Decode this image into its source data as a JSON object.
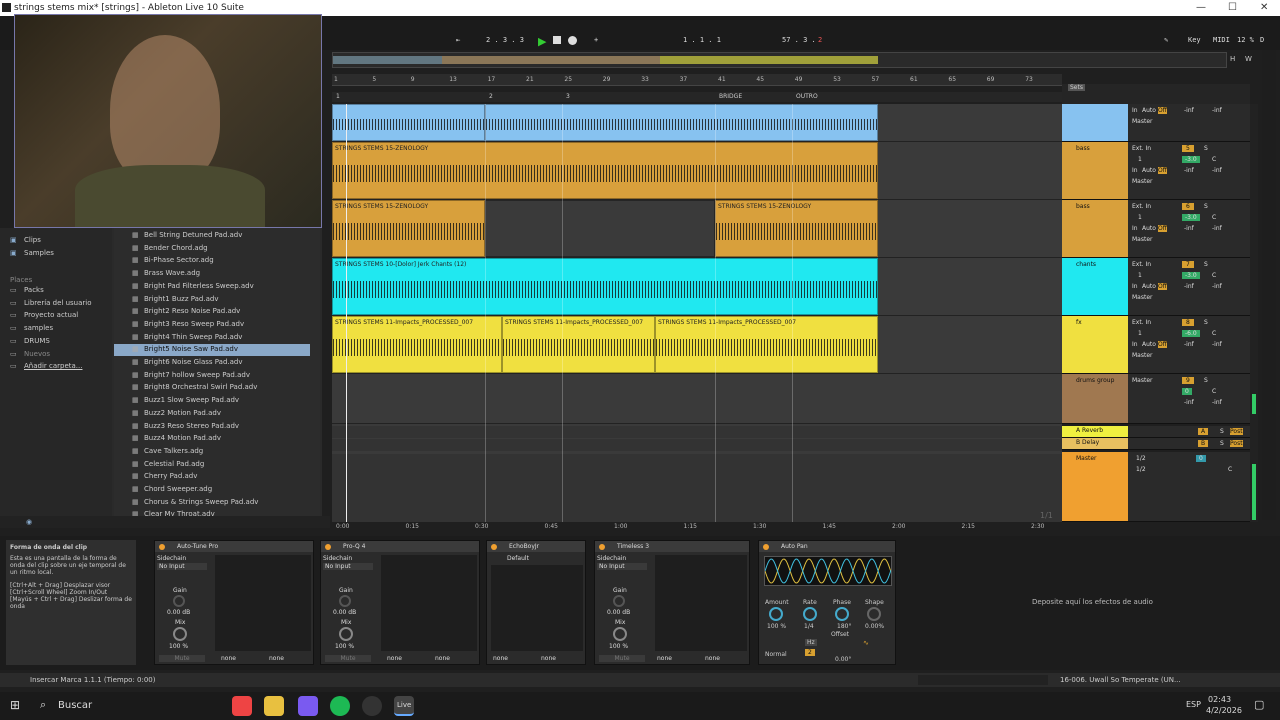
{
  "window": {
    "title": "strings stems mix* [strings] - Ableton Live 10 Suite",
    "minimize": "—",
    "maximize": "☐",
    "close": "✕"
  },
  "transport": {
    "tempo_nudge": "2 . 3 . 3",
    "position": "1 . 1 . 1",
    "loop_len": "57 . 3 .",
    "loop_len_end": "2",
    "key_label": "Key",
    "midi_label": "MIDI",
    "cpu": "12 %",
    "cpu_d": "D"
  },
  "ruler": {
    "bars": [
      "1",
      "5",
      "9",
      "13",
      "17",
      "21",
      "25",
      "29",
      "33",
      "37",
      "41",
      "45",
      "49",
      "53",
      "57",
      "61",
      "65",
      "69",
      "73"
    ]
  },
  "locators": [
    {
      "label": "1"
    },
    {
      "label": "2"
    },
    {
      "label": "3"
    },
    {
      "label": "BRIDGE"
    },
    {
      "label": "OUTRO"
    }
  ],
  "tracks": [
    {
      "name": "",
      "clips": [
        {
          "label": ""
        }
      ],
      "color": "#87c2f0",
      "routing": "Master",
      "vol": "-inf",
      "vol2": "-inf",
      "auto": "Auto",
      "off": "Off",
      "in": "In"
    },
    {
      "name": "bass",
      "clips": [
        {
          "label": "STRINGS STEMS 15-ZENOLOGY"
        }
      ],
      "color": "#d8a03c",
      "ext": "Ext. In",
      "ch": "1",
      "num": "5",
      "s": "S",
      "val": "-3.0",
      "pan": "C",
      "routing": "Master",
      "vol": "-inf",
      "vol2": "-inf",
      "auto": "Auto",
      "off": "Off",
      "in": "In"
    },
    {
      "name": "bass",
      "clips": [
        {
          "label": "STRINGS STEMS 15-ZENOLOGY"
        },
        {
          "label": "STRINGS STEMS 15-ZENOLOGY"
        }
      ],
      "color": "#d8a03c",
      "ext": "Ext. In",
      "ch": "1",
      "num": "6",
      "s": "S",
      "val": "-3.0",
      "pan": "C",
      "routing": "Master",
      "vol": "-inf",
      "vol2": "-inf",
      "auto": "Auto",
      "off": "Off",
      "in": "In"
    },
    {
      "name": "chants",
      "clips": [
        {
          "label": "STRINGS STEMS 10-[Dolor] Jerk Chants (12)"
        }
      ],
      "color": "#20e8f0",
      "ext": "Ext. In",
      "ch": "1",
      "num": "7",
      "s": "S",
      "val": "-3.0",
      "pan": "C",
      "routing": "Master",
      "vol": "-inf",
      "vol2": "-inf",
      "auto": "Auto",
      "off": "Off",
      "in": "In"
    },
    {
      "name": "fx",
      "clips": [
        {
          "label": "STRINGS STEMS 11-Impacts_PROCESSED_007"
        },
        {
          "label": "STRINGS STEMS 11-Impacts_PROCESSED_007"
        },
        {
          "label": "STRINGS STEMS 11-Impacts_PROCESSED_007"
        }
      ],
      "color": "#f0e040",
      "ext": "Ext. In",
      "ch": "1",
      "num": "8",
      "s": "S",
      "val": "-6.0",
      "pan": "C",
      "routing": "Master",
      "vol": "-inf",
      "vol2": "-inf",
      "auto": "Auto",
      "off": "Off",
      "in": "In"
    },
    {
      "name": "drums group",
      "clips": [],
      "color": "#a07850",
      "routing": "Master",
      "num": "9",
      "s": "S",
      "val": "0",
      "pan": "C",
      "vol": "-inf",
      "vol2": "-inf"
    }
  ],
  "returns": [
    {
      "name": "A Reverb",
      "num": "A",
      "s": "S",
      "post": "Post"
    },
    {
      "name": "B Delay",
      "num": "B",
      "s": "S",
      "post": "Post"
    }
  ],
  "master": {
    "name": "Master",
    "cue": "1/2",
    "out": "1/2",
    "num": "0",
    "pan": "C"
  },
  "time_ruler": [
    "0:00",
    "0:15",
    "0:30",
    "0:45",
    "1:00",
    "1:15",
    "1:30",
    "1:45",
    "2:00",
    "2:15",
    "2:30"
  ],
  "page_indicator": "1/1",
  "sends_label": "Sets",
  "browser": {
    "categories": [
      {
        "label": "Clips"
      },
      {
        "label": "Samples"
      }
    ],
    "places_header": "Places",
    "places": [
      {
        "label": "Packs"
      },
      {
        "label": "Librería del usuario"
      },
      {
        "label": "Proyecto actual"
      },
      {
        "label": "samples"
      },
      {
        "label": "DRUMS"
      },
      {
        "label": "Nuevos"
      },
      {
        "label": "Añadir carpeta..."
      }
    ],
    "files": [
      "Bell String Detuned Pad.adv",
      "Bender Chord.adg",
      "Bi-Phase Sector.adg",
      "Brass Wave.adg",
      "Bright Pad Filterless Sweep.adv",
      "Bright1 Buzz Pad.adv",
      "Bright2 Reso Noise Pad.adv",
      "Bright3 Reso Sweep Pad.adv",
      "Bright4 Thin Sweep Pad.adv",
      "Bright5 Noise Saw Pad.adv",
      "Bright6 Noise Glass Pad.adv",
      "Bright7 hollow Sweep Pad.adv",
      "Bright8 Orchestral Swirl Pad.adv",
      "Buzz1 Slow Sweep Pad.adv",
      "Buzz2 Motion Pad.adv",
      "Buzz3 Reso Stereo Pad.adv",
      "Buzz4 Motion Pad.adv",
      "Cave Talkers.adg",
      "Celestial Pad.adg",
      "Cherry Pad.adv",
      "Chord Sweeper.adg",
      "Chorus & Strings Sweep Pad.adv",
      "Clear My Throat.adv"
    ]
  },
  "info": {
    "title": "Forma de onda del clip",
    "body": "Esta es una pantalla de la forma de onda del clip sobre un eje temporal de un ritmo local.",
    "help": "[Ctrl+Alt + Drag] Desplazar visor\n[Ctrl+Scroll Wheel] Zoom In/Out\n[Mayús + Ctrl + Drag] Deslizar forma de onda"
  },
  "devices": [
    {
      "name": "Auto-Tune Pro",
      "sidechain": "Sidechain",
      "input": "No Input",
      "gain": "Gain",
      "gain_val": "0.00 dB",
      "mix": "Mix",
      "mix_val": "100 %",
      "mute": "Mute",
      "none1": "none",
      "none2": "none"
    },
    {
      "name": "Pro-Q 4",
      "sidechain": "Sidechain",
      "input": "No Input",
      "gain": "Gain",
      "gain_val": "0.00 dB",
      "mix": "Mix",
      "mix_val": "100 %",
      "mute": "Mute",
      "none1": "none",
      "none2": "none"
    },
    {
      "name": "EchoBoyJr",
      "preset": "Default",
      "none1": "none",
      "none2": "none"
    },
    {
      "name": "Timeless 3",
      "sidechain": "Sidechain",
      "input": "No Input",
      "gain": "Gain",
      "gain_val": "0.00 dB",
      "mix": "Mix",
      "mix_val": "100 %",
      "mute": "Mute",
      "none1": "none",
      "none2": "none"
    }
  ],
  "autopan": {
    "name": "Auto Pan",
    "amount": "Amount",
    "amount_val": "100 %",
    "rate": "Rate",
    "rate_val": "1/4",
    "phase": "Phase",
    "phase_val": "180°",
    "shape": "Shape",
    "shape_val": "0.00%",
    "offset": "Offset",
    "offset_val": "0.00°",
    "mode": "Normal",
    "hz": "Hz",
    "num": "2"
  },
  "drop_hint": "Deposite aquí los efectos de audio",
  "status": {
    "left": "Insercar Marca 1.1.1 (Tiempo: 0:00)",
    "right": "16-006. Uwall So Temperate (UN..."
  },
  "taskbar": {
    "search": "Buscar",
    "lang": "ESP",
    "time": "02:43",
    "date": "4/2/2026"
  }
}
